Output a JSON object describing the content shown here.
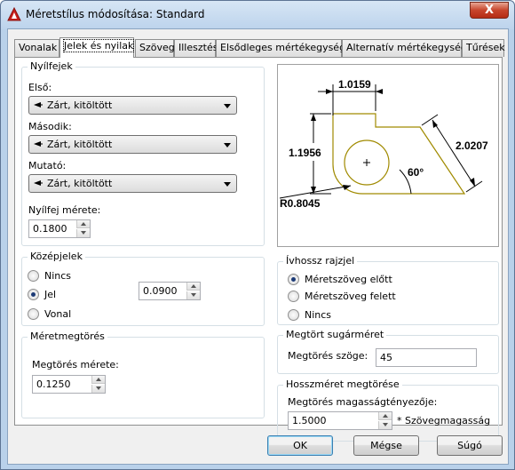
{
  "window": {
    "title": "Méretstílus módosítása: Standard",
    "close_glyph": "X"
  },
  "tabs": [
    {
      "label": "Vonalak"
    },
    {
      "label": "Jelek és nyilak"
    },
    {
      "label": "Szöveg"
    },
    {
      "label": "Illesztés"
    },
    {
      "label": "Elsődleges mértékegységek"
    },
    {
      "label": "Alternatív mértékegységek"
    },
    {
      "label": "Tűrések"
    }
  ],
  "arrowheads": {
    "group_label": "Nyílfejek",
    "first_label": "Első:",
    "first_value": "Zárt, kitöltött",
    "second_label": "Második:",
    "second_value": "Zárt, kitöltött",
    "leader_label": "Mutató:",
    "leader_value": "Zárt, kitöltött",
    "size_label": "Nyílfej mérete:",
    "size_value": "0.1800"
  },
  "center_marks": {
    "group_label": "Középjelek",
    "options": [
      "Nincs",
      "Jel",
      "Vonal"
    ],
    "selected": "Jel",
    "size_value": "0.0900"
  },
  "dimension_break": {
    "group_label": "Méretmegtörés",
    "size_label": "Megtörés mérete:",
    "size_value": "0.1250"
  },
  "preview": {
    "dim_top": "1.0159",
    "dim_left": "1.1956",
    "dim_right": "2.0207",
    "angle": "60°",
    "radius": "R0.8045",
    "colors": {
      "geometry": "#a08a00",
      "dims": "#000000"
    }
  },
  "arc_length": {
    "group_label": "Ívhossz rajzjel",
    "options": [
      "Méretszöveg előtt",
      "Méretszöveg felett",
      "Nincs"
    ],
    "selected": "Méretszöveg előtt"
  },
  "radius_jog": {
    "group_label": "Megtört sugárméret",
    "angle_label": "Megtörés szöge:",
    "angle_value": "45"
  },
  "linear_jog": {
    "group_label": "Hosszméret megtörése",
    "factor_label": "Megtörés magasságtényezője:",
    "factor_value": "1.5000",
    "suffix": "* Szövegmagasság"
  },
  "buttons": {
    "ok": "OK",
    "cancel": "Mégse",
    "help": "Súgó"
  }
}
